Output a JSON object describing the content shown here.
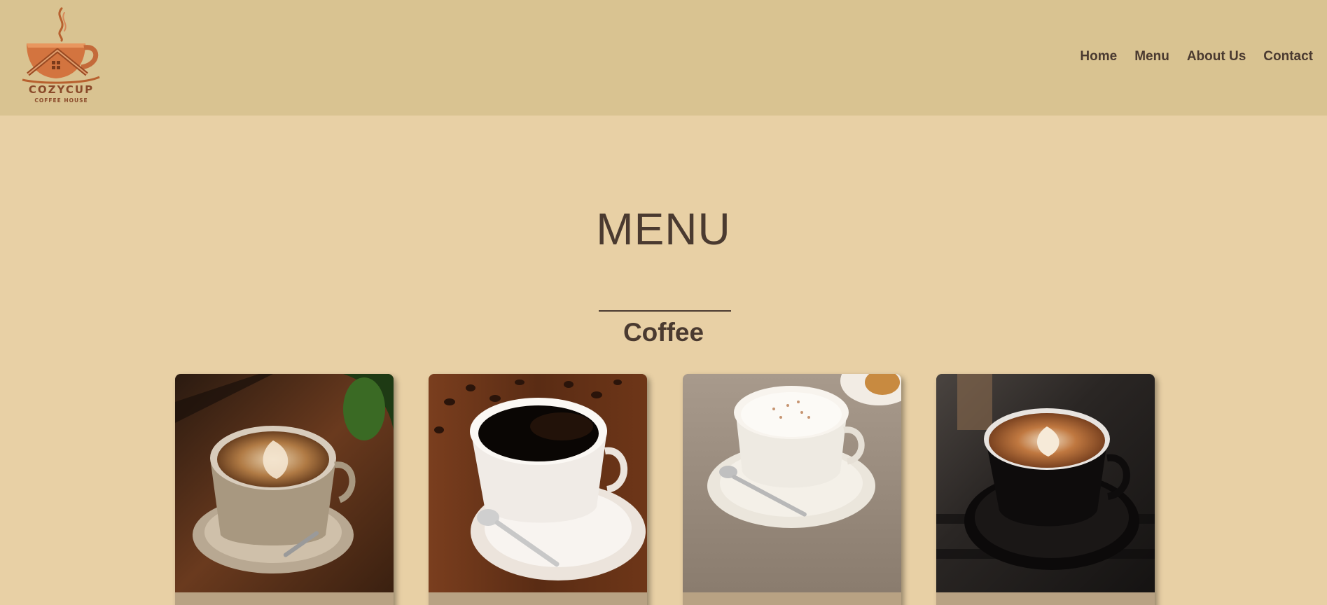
{
  "brand": {
    "name": "COZYCUP",
    "tagline": "COFFEE HOUSE"
  },
  "nav": {
    "items": [
      {
        "label": "Home"
      },
      {
        "label": "Menu"
      },
      {
        "label": "About Us"
      },
      {
        "label": "Contact"
      }
    ]
  },
  "page": {
    "title": "MENU",
    "section_title": "Coffee"
  },
  "cards": [
    {
      "image": "latte-art-cup-on-wood-table"
    },
    {
      "image": "black-coffee-cup-with-beans"
    },
    {
      "image": "cappuccino-cup-on-linen"
    },
    {
      "image": "black-cup-latte-art"
    }
  ],
  "colors": {
    "header_bg": "#d9c391",
    "page_bg": "#e8d0a5",
    "text": "#4a3a30",
    "logo": "#c46a3a"
  }
}
